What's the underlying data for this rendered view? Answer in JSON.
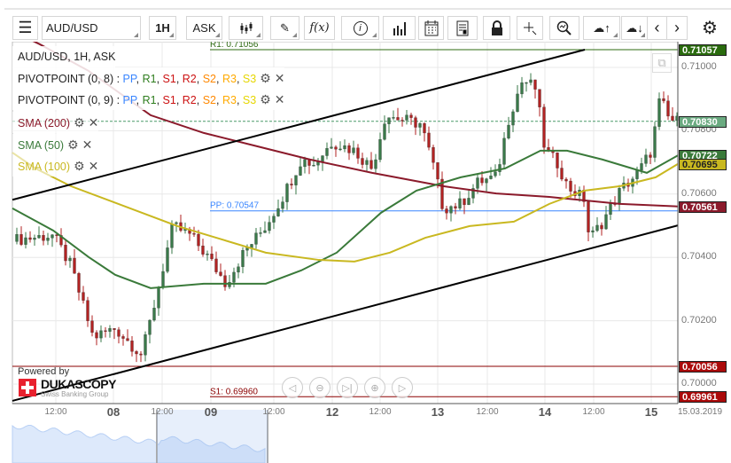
{
  "toolbar": {
    "symbol": "AUD/USD",
    "timeframe": "1H",
    "side": "ASK",
    "formula": "f(x)"
  },
  "legend": {
    "title": "AUD/USD, 1H, ASK",
    "pivots": [
      {
        "label": "PIVOTPOINT (0, 8)",
        "items": [
          "PP",
          "R1",
          "S1",
          "R2",
          "S2",
          "R3",
          "S3"
        ]
      },
      {
        "label": "PIVOTPOINT (0, 9)",
        "items": [
          "PP",
          "R1",
          "S1",
          "R2",
          "S2",
          "R3",
          "S3"
        ]
      }
    ],
    "pivot_colors": [
      "#3a86ff",
      "#2e7d1e",
      "#cc1111",
      "#cc1111",
      "#ff8800",
      "#ffaa00",
      "#e6d600"
    ],
    "sma": [
      {
        "label": "SMA (200)",
        "color": "#8b1a2b"
      },
      {
        "label": "SMA (50)",
        "color": "#3a7a3a"
      },
      {
        "label": "SMA (100)",
        "color": "#c9b820"
      }
    ]
  },
  "pivot_lines": [
    {
      "label": "R1: 0.71056",
      "price": 0.71056,
      "color": "#2e6b12"
    },
    {
      "label": "PP: 0.70547",
      "price": 0.70547,
      "color": "#3a86ff"
    },
    {
      "label": "S1: 0.69960",
      "price": 0.6996,
      "color": "#8b0000"
    }
  ],
  "price_labels": [
    {
      "text": "0.71057",
      "price": 0.71057,
      "color": "#2a6b0e"
    },
    {
      "text": "0.70830",
      "price": 0.7083,
      "color": "#6aaa80"
    },
    {
      "text": "0.70722",
      "price": 0.70722,
      "color": "#3a7a3a"
    },
    {
      "text": "0.70695",
      "price": 0.70695,
      "color": "#c9b820",
      "textColor": "#222"
    },
    {
      "text": "0.70561",
      "price": 0.70561,
      "color": "#8b1a2b"
    },
    {
      "text": "0.70056",
      "price": 0.70056,
      "color": "#aa0a0a"
    },
    {
      "text": "0.69961",
      "price": 0.69961,
      "color": "#aa0a0a"
    }
  ],
  "branding": {
    "powered": "Powered by",
    "name": "DUKASCOPY",
    "sub": "Swiss Banking Group"
  },
  "chart_data": {
    "type": "candlestick",
    "title": "AUD/USD, 1H, ASK",
    "ylim": [
      0.6994,
      0.7113
    ],
    "y_ticks": [
      "0.71000",
      "0.70800",
      "0.70600",
      "0.70400",
      "0.70200",
      "0.70000"
    ],
    "x_ticks": [
      {
        "label": "12:00",
        "hour": 9.8,
        "bold": false
      },
      {
        "label": "08",
        "hour": 22.8,
        "bold": true
      },
      {
        "label": "12:00",
        "hour": 33.8,
        "bold": false
      },
      {
        "label": "09",
        "hour": 44.8,
        "bold": true
      },
      {
        "label": "12:00",
        "hour": 59,
        "bold": false
      },
      {
        "label": "12",
        "hour": 72.2,
        "bold": true
      },
      {
        "label": "12:00",
        "hour": 83,
        "bold": false
      },
      {
        "label": "13",
        "hour": 96,
        "bold": true
      },
      {
        "label": "12:00",
        "hour": 107.2,
        "bold": false
      },
      {
        "label": "14",
        "hour": 120.2,
        "bold": true
      },
      {
        "label": "12:00",
        "hour": 131.2,
        "bold": false
      },
      {
        "label": "15",
        "hour": 144.2,
        "bold": true
      }
    ],
    "date_label": "15.03.2019",
    "hours": 150,
    "close_anchors": [
      [
        0,
        0.7045
      ],
      [
        1.2,
        0.70457
      ],
      [
        9.2,
        0.7047
      ],
      [
        13.2,
        0.70373
      ],
      [
        18.2,
        0.70148
      ],
      [
        23.2,
        0.70176
      ],
      [
        29.2,
        0.70092
      ],
      [
        32.2,
        0.7026
      ],
      [
        36.2,
        0.70499
      ],
      [
        40.2,
        0.7047
      ],
      [
        44.2,
        0.704
      ],
      [
        48.2,
        0.70317
      ],
      [
        52.2,
        0.70415
      ],
      [
        57.2,
        0.70499
      ],
      [
        61.2,
        0.70597
      ],
      [
        65.2,
        0.70709
      ],
      [
        68.2,
        0.70695
      ],
      [
        72.2,
        0.70765
      ],
      [
        77.2,
        0.70737
      ],
      [
        81.2,
        0.7068
      ],
      [
        84.2,
        0.70849
      ],
      [
        88.2,
        0.70835
      ],
      [
        92.2,
        0.70821
      ],
      [
        95.2,
        0.7068
      ],
      [
        97.2,
        0.70555
      ],
      [
        101.2,
        0.70569
      ],
      [
        105.2,
        0.70639
      ],
      [
        109.2,
        0.70653
      ],
      [
        112.2,
        0.70849
      ],
      [
        115.2,
        0.70961
      ],
      [
        118.2,
        0.70933
      ],
      [
        120.2,
        0.70737
      ],
      [
        123.2,
        0.70695
      ],
      [
        125.2,
        0.70625
      ],
      [
        129.2,
        0.70583
      ],
      [
        130.2,
        0.70457
      ],
      [
        133.2,
        0.70513
      ],
      [
        137.2,
        0.70611
      ],
      [
        141.2,
        0.70667
      ],
      [
        144.2,
        0.70737
      ],
      [
        146.2,
        0.70905
      ],
      [
        148.2,
        0.70835
      ],
      [
        150,
        0.7083
      ]
    ],
    "sma200": [
      [
        0,
        0.71115
      ],
      [
        6.2,
        0.71073
      ],
      [
        17.2,
        0.70989
      ],
      [
        31.2,
        0.70849
      ],
      [
        43.2,
        0.70793
      ],
      [
        55.2,
        0.70751
      ],
      [
        67.2,
        0.70709
      ],
      [
        81.2,
        0.70667
      ],
      [
        97.2,
        0.70625
      ],
      [
        109.2,
        0.70602
      ],
      [
        121.2,
        0.70591
      ],
      [
        137.2,
        0.70569
      ],
      [
        150.2,
        0.70561
      ]
    ],
    "sma50": [
      [
        0,
        0.70555
      ],
      [
        9.2,
        0.70485
      ],
      [
        17.2,
        0.70401
      ],
      [
        23.2,
        0.70345
      ],
      [
        31.2,
        0.70303
      ],
      [
        43.2,
        0.70317
      ],
      [
        57.2,
        0.70317
      ],
      [
        65.2,
        0.70359
      ],
      [
        73.2,
        0.70415
      ],
      [
        83.2,
        0.70541
      ],
      [
        91.2,
        0.70611
      ],
      [
        101.2,
        0.70653
      ],
      [
        111.2,
        0.70681
      ],
      [
        119.2,
        0.70737
      ],
      [
        125.2,
        0.70737
      ],
      [
        133.2,
        0.70709
      ],
      [
        143.2,
        0.70667
      ],
      [
        150.2,
        0.70722
      ]
    ],
    "sma100": [
      [
        0,
        0.70731
      ],
      [
        5.2,
        0.70681
      ],
      [
        13.2,
        0.70625
      ],
      [
        21.2,
        0.70583
      ],
      [
        29.2,
        0.70541
      ],
      [
        37.2,
        0.70499
      ],
      [
        47.2,
        0.70457
      ],
      [
        57.2,
        0.70415
      ],
      [
        69.2,
        0.70392
      ],
      [
        77.2,
        0.70387
      ],
      [
        85.2,
        0.70415
      ],
      [
        93.2,
        0.70462
      ],
      [
        103.2,
        0.70499
      ],
      [
        113.2,
        0.70513
      ],
      [
        121.2,
        0.70569
      ],
      [
        129.2,
        0.70611
      ],
      [
        137.2,
        0.70625
      ],
      [
        145.2,
        0.70653
      ],
      [
        150.2,
        0.70695
      ]
    ],
    "trendlines": [
      [
        [
          0,
          0.70582
        ],
        [
          129.2,
          0.71056
        ]
      ],
      [
        [
          0,
          0.69947
        ],
        [
          150.2,
          0.70501
        ]
      ]
    ],
    "last_price": 0.7083
  }
}
